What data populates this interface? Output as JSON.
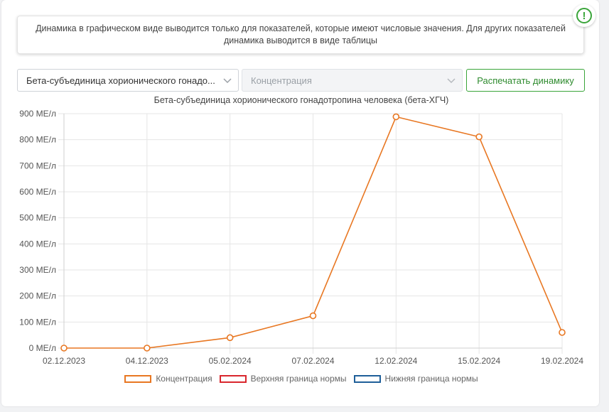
{
  "notice": {
    "text": "Динамика в графическом виде выводится только для показателей, которые имеют числовые значения. Для других показателей динамика выводится в виде таблицы"
  },
  "alert_icon": "exclamation-circle-icon",
  "controls": {
    "indicator_select": "Бета-субъединица хорионического гонадо...",
    "metric_select_placeholder": "Концентрация",
    "print_button": "Распечатать динамику"
  },
  "colors": {
    "accent_green": "#3aa53a",
    "series_concentration": "#e87722",
    "series_upper": "#d9262d",
    "series_lower": "#1f5f99"
  },
  "chart_data": {
    "type": "line",
    "title": "Бета-субъединица хорионического гонадотропина человека (бета-ХГЧ)",
    "categories": [
      "02.12.2023",
      "04.12.2023",
      "05.02.2024",
      "07.02.2024",
      "12.02.2024",
      "15.02.2024",
      "19.02.2024"
    ],
    "series": [
      {
        "name": "Концентрация",
        "color": "#e87722",
        "values": [
          0,
          0,
          40,
          124,
          888,
          811,
          60
        ]
      },
      {
        "name": "Верхняя граница нормы",
        "color": "#d9262d",
        "values": []
      },
      {
        "name": "Нижняя граница нормы",
        "color": "#1f5f99",
        "values": []
      }
    ],
    "ylim": [
      0,
      900
    ],
    "yticks": [
      "0 МЕ/л",
      "100 МЕ/л",
      "200 МЕ/л",
      "300 МЕ/л",
      "400 МЕ/л",
      "500 МЕ/л",
      "600 МЕ/л",
      "700 МЕ/л",
      "800 МЕ/л",
      "900 МЕ/л"
    ],
    "grid": true,
    "legend_position": "bottom"
  }
}
